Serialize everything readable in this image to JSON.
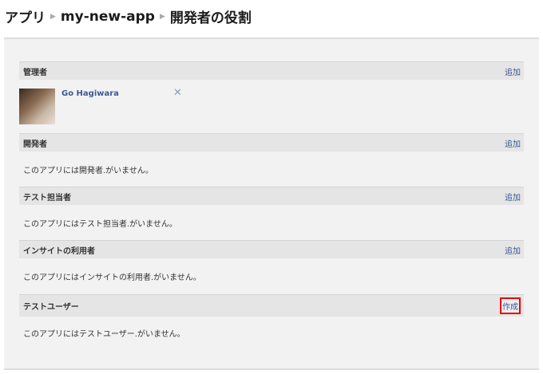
{
  "breadcrumb": [
    "アプリ",
    "my-new-app",
    "開発者の役割"
  ],
  "sections": [
    {
      "title": "管理者",
      "action": "追加"
    },
    {
      "title": "開発者",
      "action": "追加",
      "empty": "このアプリには開発者.がいません。"
    },
    {
      "title": "テスト担当者",
      "action": "追加",
      "empty": "このアプリにはテスト担当者.がいません。"
    },
    {
      "title": "インサイトの利用者",
      "action": "追加",
      "empty": "このアプリにはインサイトの利用者.がいません。"
    },
    {
      "title": "テストユーザー",
      "action": "作成",
      "empty": "このアプリにはテストユーザー.がいません。"
    }
  ],
  "admin": {
    "name": "Go Hagiwara",
    "remove": "✕"
  }
}
